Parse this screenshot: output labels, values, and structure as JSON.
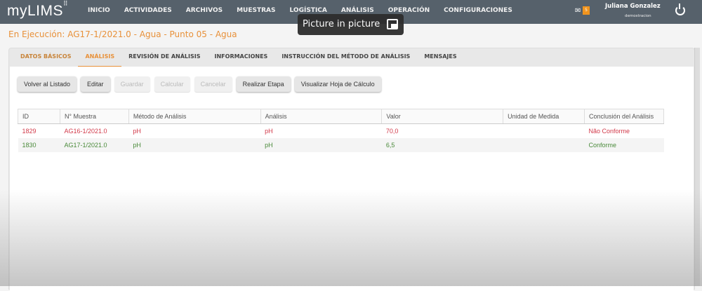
{
  "app": {
    "logo": "myLIMS"
  },
  "nav": {
    "items": [
      "INICIO",
      "ACTIVIDADES",
      "ARCHIVOS",
      "MUESTRAS",
      "LOGÍSTICA",
      "ANÁLISIS",
      "OPERACIÓN",
      "CONFIGURACIONES"
    ],
    "mail_count": "5",
    "user_name": "Juliana Gonzalez",
    "user_role": "demostracion"
  },
  "pip": {
    "label": "Picture in picture"
  },
  "page": {
    "title": "En Ejecución: AG17-1/2021.0 - Agua - Punto 05 - Agua"
  },
  "tabs": [
    "DATOS BÁSICOS",
    "ANÁLISIS",
    "REVISIÓN DE ANÁLISIS",
    "INFORMACIONES",
    "INSTRUCCIÓN DEL MÉTODO DE ANÁLISIS",
    "MENSAJES"
  ],
  "buttons": [
    {
      "label": "Volver al Listado",
      "enabled": true
    },
    {
      "label": "Editar",
      "enabled": true
    },
    {
      "label": "Guardar",
      "enabled": false
    },
    {
      "label": "Calcular",
      "enabled": false
    },
    {
      "label": "Cancelar",
      "enabled": false
    },
    {
      "label": "Realizar Etapa",
      "enabled": true
    },
    {
      "label": "Visualizar Hoja de Cálculo",
      "enabled": true
    }
  ],
  "table": {
    "headers": [
      "ID",
      "N° Muestra",
      "Método de Análisis",
      "Análisis",
      "Valor",
      "Unidad de Medida",
      "Conclusión del Análisis"
    ],
    "rows": [
      [
        "1829",
        "AG16-1/2021.0",
        "pH",
        "pH",
        "70,0",
        "",
        "Não Conforme"
      ],
      [
        "1830",
        "AG17-1/2021.0",
        "pH",
        "pH",
        "6,5",
        "",
        "Conforme"
      ]
    ]
  },
  "colors": {
    "nav": "#56616b",
    "accent": "#e8913a",
    "nonconform": "#d23a4a",
    "conform": "#4a8a3a"
  }
}
